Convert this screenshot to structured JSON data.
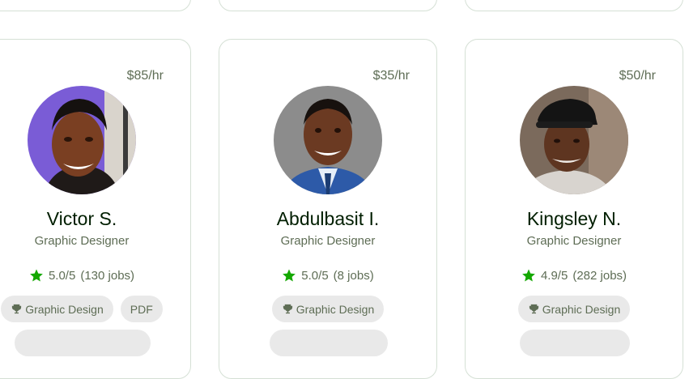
{
  "freelancers": [
    {
      "rate": "$85/hr",
      "name": "Victor S.",
      "title": "Graphic Designer",
      "rating": "5.0/5",
      "jobs": "(130 jobs)",
      "skills": [
        "Graphic Design",
        "PDF"
      ]
    },
    {
      "rate": "$35/hr",
      "name": "Abdulbasit I.",
      "title": "Graphic Designer",
      "rating": "5.0/5",
      "jobs": "(8 jobs)",
      "skills": [
        "Graphic Design"
      ]
    },
    {
      "rate": "$50/hr",
      "name": "Kingsley N.",
      "title": "Graphic Designer",
      "rating": "4.9/5",
      "jobs": "(282 jobs)",
      "skills": [
        "Graphic Design"
      ]
    }
  ],
  "colors": {
    "star": "#14a800",
    "border": "#d5e0d5",
    "chip_bg": "#e9e9e9",
    "muted_text": "#5e6d55"
  },
  "icons": [
    "star-icon",
    "trophy-icon"
  ]
}
